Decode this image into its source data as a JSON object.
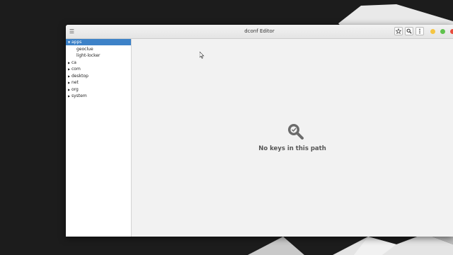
{
  "window": {
    "title": "dconf Editor"
  },
  "sidebar": {
    "items": [
      {
        "label": "apps",
        "expanded": true,
        "selected": true,
        "level": 0
      },
      {
        "label": "geoclue",
        "level": 1
      },
      {
        "label": "light-locker",
        "level": 1
      },
      {
        "label": "ca",
        "level": 0
      },
      {
        "label": "com",
        "level": 0
      },
      {
        "label": "desktop",
        "level": 0
      },
      {
        "label": "net",
        "level": 0
      },
      {
        "label": "org",
        "level": 0
      },
      {
        "label": "system",
        "level": 0
      }
    ]
  },
  "main": {
    "empty_message": "No keys in this path"
  },
  "controls": {
    "menu_icon": "hamburger-icon",
    "bookmark_icon": "star-icon",
    "search_icon": "search-icon",
    "more_icon": "kebab-icon"
  },
  "colors": {
    "selection": "#3d82c8",
    "minimize": "#f5c542",
    "maximize": "#5fc24d",
    "close": "#e74c3c"
  }
}
